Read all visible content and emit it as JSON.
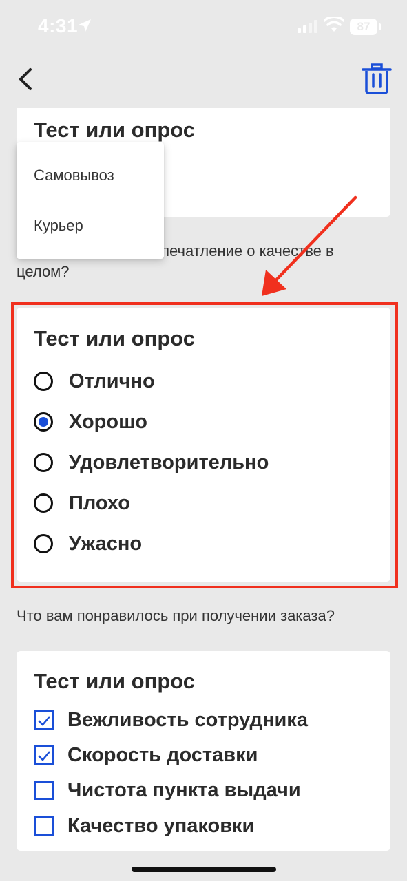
{
  "status_bar": {
    "time": "4:31",
    "battery": "87"
  },
  "cards": {
    "top": {
      "title": "Тест или опрос"
    },
    "radio": {
      "title": "Тест или опрос",
      "options": [
        "Отлично",
        "Хорошо",
        "Удовлетворительно",
        "Плохо",
        "Ужасно"
      ],
      "selected_index": 1
    },
    "checkbox": {
      "title": "Тест или опрос",
      "options": [
        {
          "label": "Вежливость сотрудника",
          "checked": true
        },
        {
          "label": "Скорость доставки",
          "checked": true
        },
        {
          "label": "Чистота пункта выдачи",
          "checked": false
        },
        {
          "label": "Качество упаковки",
          "checked": false
        }
      ]
    }
  },
  "questions": {
    "q1": "Какое ваше общее впечатление о качестве в целом?",
    "q2": "Что вам понравилось при получении заказа?"
  },
  "dropdown": {
    "items": [
      "Самовывоз",
      "Курьер"
    ]
  },
  "colors": {
    "accent": "#1a4fd8",
    "highlight": "#f0301e",
    "background": "#e9e9e9"
  },
  "icons": {
    "back": "chevron-left-icon",
    "trash": "trash-icon",
    "location": "location-arrow-icon",
    "signal": "signal-icon",
    "wifi": "wifi-icon",
    "battery": "battery-icon"
  }
}
